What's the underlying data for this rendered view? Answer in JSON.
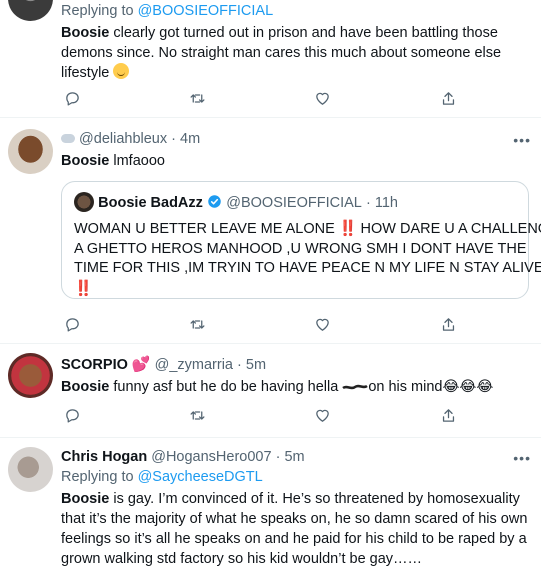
{
  "tweet1": {
    "replying_prefix": "Replying to",
    "replying_handle": "@BOOSIEOFFICIAL",
    "mention": "Boosie",
    "text": " clearly got turned out in prison and have been battling those demons since. No straight man cares this much about someone else lifestyle"
  },
  "tweet2": {
    "display_name": "",
    "handle": "@deliahbleux",
    "time": "· 4m",
    "mention": "Boosie",
    "text": " lmfaooo",
    "quote": {
      "display_name": "Boosie BadAzz",
      "handle": "@BOOSIEOFFICIAL",
      "time": "· 11h",
      "line1": "WOMAN U BETTER LEAVE ME ALONE",
      "line1b": "HOW DARE U A CHALLENGE",
      "line2": "A GHETTO HEROS MANHOOD ,U WRONG SMH I DONT HAVE THE",
      "line3": "TIME FOR THIS ,IM TRYIN TO HAVE PEACE N MY LIFE N STAY ALIVE",
      "bang": "‼️"
    }
  },
  "tweet3": {
    "display_name": "SCORPIO",
    "handle": "@_zymarria",
    "time": "· 5m",
    "mention": "Boosie",
    "text_a": " funny asf but he do be having hella",
    "text_b": "on his mind",
    "emojis": "😂😂😂"
  },
  "tweet4": {
    "display_name": "Chris Hogan",
    "handle": "@HogansHero007",
    "time": "· 5m",
    "replying_prefix": "Replying to",
    "replying_handle": "@SaycheeseDGTL",
    "mention": "Boosie",
    "line1": " is gay. I’m convinced of it. He’s so threatened by homosexuality",
    "line2": "that it’s the majority of what he speaks on, he so damn scared of his own",
    "line3": "feelings so it’s all he speaks on and he paid for his child to be raped by a",
    "line4": "grown walking std factory so his kid wouldn’t be gay……"
  },
  "more_label": "•••"
}
